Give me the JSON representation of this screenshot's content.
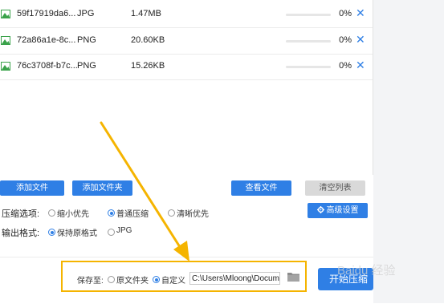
{
  "files": [
    {
      "name": "59f17919da6...",
      "type": "JPG",
      "size": "1.47MB",
      "progress_text": "0%",
      "progress": 0
    },
    {
      "name": "72a86a1e-8c...",
      "type": "PNG",
      "size": "20.60KB",
      "progress_text": "0%",
      "progress": 0
    },
    {
      "name": "76c3708f-b7c...",
      "type": "PNG",
      "size": "15.26KB",
      "progress_text": "0%",
      "progress": 0
    }
  ],
  "icons": {
    "file": "image-file-icon",
    "remove": "close-icon",
    "settings": "gear-icon",
    "folder": "folder-icon"
  },
  "remove_symbol": "✕",
  "toolbar": {
    "add_file": "添加文件",
    "add_folder": "添加文件夹",
    "view_files": "查看文件",
    "clear_list": "清空列表"
  },
  "compress": {
    "label": "压缩选项:",
    "options": [
      "缩小优先",
      "普通压缩",
      "清晰优先"
    ],
    "selected": "普通压缩"
  },
  "advanced_settings": "高级设置",
  "output": {
    "label": "输出格式:",
    "options": [
      "保持原格式",
      "JPG"
    ],
    "selected": "保持原格式"
  },
  "save": {
    "label": "保存至:",
    "options": [
      "原文件夹",
      "自定义"
    ],
    "selected": "自定义",
    "path": "C:\\Users\\Mloong\\Docume"
  },
  "start_button": "开始压缩",
  "watermark": "Baidu 经验",
  "colors": {
    "accent": "#2f7fe5",
    "highlight_box": "#f5b400",
    "gray_button": "#d9d9d9"
  }
}
